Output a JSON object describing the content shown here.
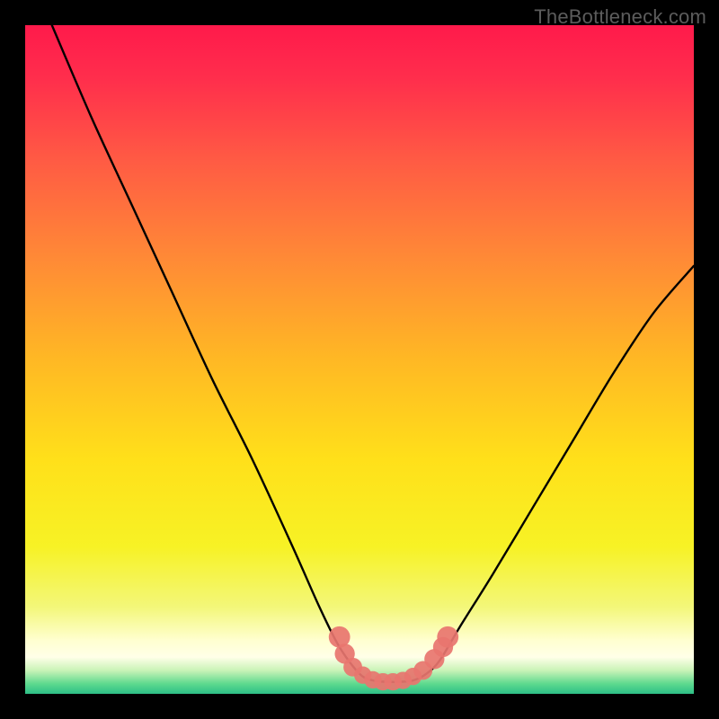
{
  "watermark": "TheBottleneck.com",
  "chart_data": {
    "type": "line",
    "title": "",
    "xlabel": "",
    "ylabel": "",
    "xlim": [
      0,
      100
    ],
    "ylim": [
      0,
      100
    ],
    "legend": false,
    "grid": false,
    "background_gradient": {
      "stops": [
        {
          "offset": 0.0,
          "color": "#ff1a4b"
        },
        {
          "offset": 0.08,
          "color": "#ff2e4c"
        },
        {
          "offset": 0.2,
          "color": "#ff5a44"
        },
        {
          "offset": 0.35,
          "color": "#ff8a36"
        },
        {
          "offset": 0.5,
          "color": "#ffb824"
        },
        {
          "offset": 0.65,
          "color": "#ffe01a"
        },
        {
          "offset": 0.78,
          "color": "#f7f225"
        },
        {
          "offset": 0.87,
          "color": "#f3f779"
        },
        {
          "offset": 0.92,
          "color": "#ffffd0"
        },
        {
          "offset": 0.945,
          "color": "#ffffe8"
        },
        {
          "offset": 0.965,
          "color": "#c9f3b7"
        },
        {
          "offset": 0.985,
          "color": "#5dd98e"
        },
        {
          "offset": 1.0,
          "color": "#2dbf87"
        }
      ]
    },
    "series": [
      {
        "name": "curve",
        "color": "#000000",
        "x": [
          4,
          10,
          16,
          22,
          28,
          34,
          40,
          44,
          47,
          50,
          52,
          54,
          56,
          58,
          60,
          62,
          65,
          70,
          76,
          82,
          88,
          94,
          100
        ],
        "y": [
          100,
          86,
          73,
          60,
          47,
          35,
          22,
          13,
          7,
          3,
          2,
          1.8,
          1.8,
          2,
          3,
          5,
          10,
          18,
          28,
          38,
          48,
          57,
          64
        ]
      }
    ],
    "markers": {
      "color": "#e8756f",
      "points": [
        {
          "x": 47.0,
          "y": 8.5,
          "r": 1.6
        },
        {
          "x": 47.8,
          "y": 6.0,
          "r": 1.5
        },
        {
          "x": 49.0,
          "y": 4.0,
          "r": 1.4
        },
        {
          "x": 50.5,
          "y": 2.8,
          "r": 1.3
        },
        {
          "x": 52.0,
          "y": 2.1,
          "r": 1.3
        },
        {
          "x": 53.5,
          "y": 1.8,
          "r": 1.3
        },
        {
          "x": 55.0,
          "y": 1.8,
          "r": 1.3
        },
        {
          "x": 56.5,
          "y": 2.0,
          "r": 1.3
        },
        {
          "x": 58.0,
          "y": 2.6,
          "r": 1.3
        },
        {
          "x": 59.5,
          "y": 3.5,
          "r": 1.4
        },
        {
          "x": 61.2,
          "y": 5.2,
          "r": 1.5
        },
        {
          "x": 62.5,
          "y": 7.0,
          "r": 1.5
        },
        {
          "x": 63.2,
          "y": 8.5,
          "r": 1.6
        }
      ]
    }
  }
}
